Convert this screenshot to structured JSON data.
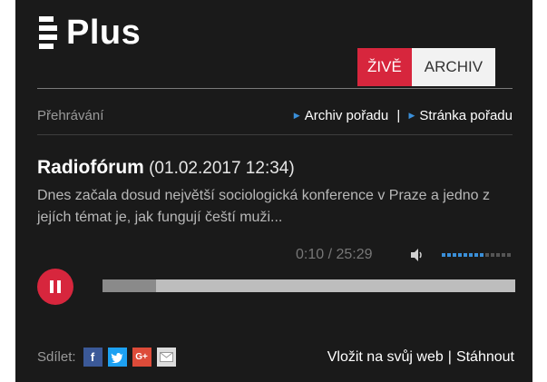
{
  "station": {
    "name": "Plus"
  },
  "tabs": [
    {
      "label": "ŽIVĚ",
      "active": true
    },
    {
      "label": "ARCHIV",
      "active": false
    }
  ],
  "subnav": {
    "player_label": "Přehrávání",
    "archive_link": "Archiv pořadu",
    "separator": "|",
    "show_link": "Stránka pořadu"
  },
  "episode": {
    "title": "Radiofórum",
    "date": "(01.02.2017 12:34)",
    "description": "Dnes začala dosud největší sociologická konference v Praze a jedno z jejích témat je, jak fungují čeští muži..."
  },
  "playback": {
    "current_time": "0:10",
    "duration": "25:29",
    "time_display": "0:10 / 25:29",
    "state": "playing",
    "progress_fraction": 0.13,
    "volume_fraction": 0.6
  },
  "share": {
    "label": "Sdílet:",
    "networks": [
      "facebook-icon",
      "twitter-icon",
      "google-plus-icon",
      "email-icon"
    ]
  },
  "actions": {
    "embed": "Vložit na svůj web",
    "separator": "|",
    "download": "Stáhnout"
  },
  "colors": {
    "accent": "#d7263d",
    "link_marker": "#3a8fd9",
    "background": "#1a1a1a"
  }
}
